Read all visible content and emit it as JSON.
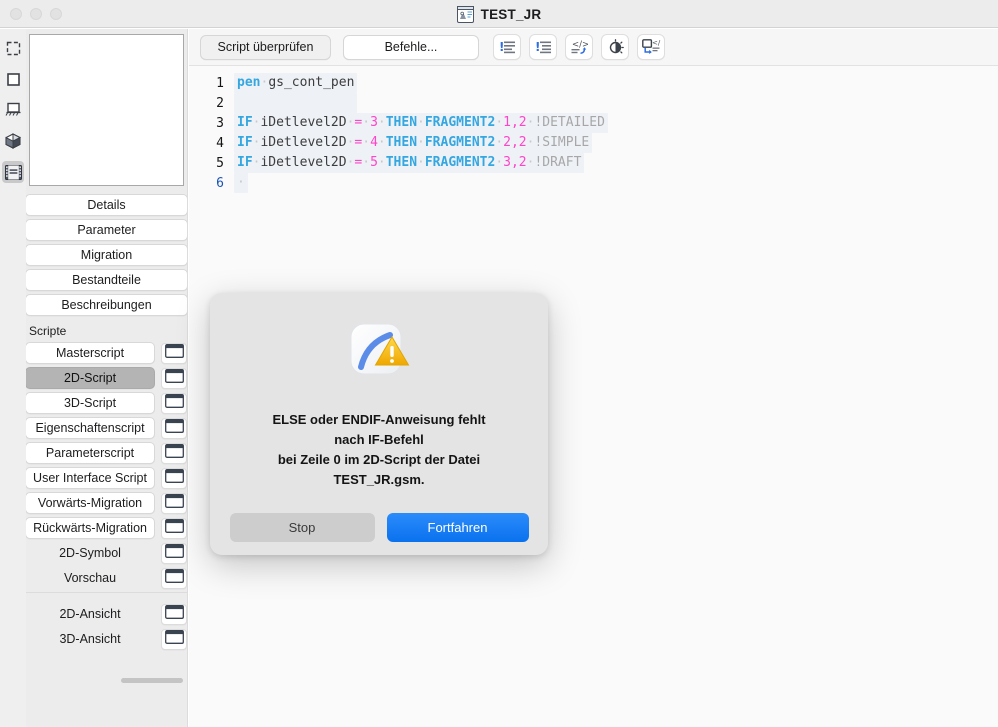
{
  "window": {
    "title": "TEST_JR",
    "doc_icon": "library-part-icon",
    "traffic_lights": [
      "close-button",
      "minimize-button",
      "zoom-button"
    ]
  },
  "iconstrip": {
    "items": [
      {
        "name": "selection-tool-icon",
        "selected": false
      },
      {
        "name": "rectangle-tool-icon",
        "selected": false
      },
      {
        "name": "floorplan-symbol-icon",
        "selected": false
      },
      {
        "name": "3d-cube-icon",
        "selected": false
      },
      {
        "name": "filmstrip-script-icon",
        "selected": true
      }
    ]
  },
  "sidebar": {
    "preview": "part-preview-empty",
    "nav_items": [
      {
        "label": "Details"
      },
      {
        "label": "Parameter"
      },
      {
        "label": "Migration"
      },
      {
        "label": "Bestandteile"
      },
      {
        "label": "Beschreibungen"
      }
    ],
    "section_label": "Scripte",
    "scripts": [
      {
        "label": "Masterscript",
        "selected": false,
        "plain": false,
        "window_button": true
      },
      {
        "label": "2D-Script",
        "selected": true,
        "plain": false,
        "window_button": true
      },
      {
        "label": "3D-Script",
        "selected": false,
        "plain": false,
        "window_button": true
      },
      {
        "label": "Eigenschaftenscript",
        "selected": false,
        "plain": false,
        "window_button": true
      },
      {
        "label": "Parameterscript",
        "selected": false,
        "plain": false,
        "window_button": true
      },
      {
        "label": "User Interface Script",
        "selected": false,
        "plain": false,
        "window_button": true
      },
      {
        "label": "Vorwärts-Migration",
        "selected": false,
        "plain": false,
        "window_button": true
      },
      {
        "label": "Rückwärts-Migration",
        "selected": false,
        "plain": false,
        "window_button": true
      },
      {
        "label": "2D-Symbol",
        "selected": false,
        "plain": true,
        "window_button": true
      },
      {
        "label": "Vorschau",
        "selected": false,
        "plain": true,
        "window_button": true
      }
    ],
    "views": [
      {
        "label": "2D-Ansicht",
        "plain": true,
        "window_button": true
      },
      {
        "label": "3D-Ansicht",
        "plain": true,
        "window_button": true
      }
    ]
  },
  "toolbar": {
    "check_script_label": "Script überprüfen",
    "commands_label": "Befehle...",
    "icons": [
      {
        "name": "indent-errors-left-icon"
      },
      {
        "name": "indent-errors-right-icon"
      },
      {
        "name": "code-export-icon"
      },
      {
        "name": "contrast-icon"
      },
      {
        "name": "code-window-icon"
      }
    ]
  },
  "editor": {
    "lines": [
      {
        "number": "1",
        "current": false,
        "tokens": [
          {
            "t": "pen",
            "c": "kw"
          },
          {
            "t": "·",
            "c": "dot"
          },
          {
            "t": "gs_cont_pen",
            "c": "id"
          }
        ]
      },
      {
        "number": "2",
        "current": false,
        "tokens": []
      },
      {
        "number": "3",
        "current": false,
        "tokens": [
          {
            "t": "IF",
            "c": "kw"
          },
          {
            "t": "·",
            "c": "dot"
          },
          {
            "t": "iDetlevel2D",
            "c": "id"
          },
          {
            "t": "·",
            "c": "dot"
          },
          {
            "t": "=",
            "c": "op"
          },
          {
            "t": "·",
            "c": "dot"
          },
          {
            "t": "3",
            "c": "num"
          },
          {
            "t": "·",
            "c": "dot"
          },
          {
            "t": "THEN",
            "c": "kw"
          },
          {
            "t": "·",
            "c": "dot"
          },
          {
            "t": "FRAGMENT2",
            "c": "kw"
          },
          {
            "t": "·",
            "c": "dot"
          },
          {
            "t": "1,2",
            "c": "num"
          },
          {
            "t": "·",
            "c": "dot"
          },
          {
            "t": "!DETAILED",
            "c": "cmt"
          }
        ]
      },
      {
        "number": "4",
        "current": false,
        "tokens": [
          {
            "t": "IF",
            "c": "kw"
          },
          {
            "t": "·",
            "c": "dot"
          },
          {
            "t": "iDetlevel2D",
            "c": "id"
          },
          {
            "t": "·",
            "c": "dot"
          },
          {
            "t": "=",
            "c": "op"
          },
          {
            "t": "·",
            "c": "dot"
          },
          {
            "t": "4",
            "c": "num"
          },
          {
            "t": "·",
            "c": "dot"
          },
          {
            "t": "THEN",
            "c": "kw"
          },
          {
            "t": "·",
            "c": "dot"
          },
          {
            "t": "FRAGMENT2",
            "c": "kw"
          },
          {
            "t": "·",
            "c": "dot"
          },
          {
            "t": "2,2",
            "c": "num"
          },
          {
            "t": "·",
            "c": "dot"
          },
          {
            "t": "!SIMPLE",
            "c": "cmt"
          }
        ]
      },
      {
        "number": "5",
        "current": false,
        "tokens": [
          {
            "t": "IF",
            "c": "kw"
          },
          {
            "t": "·",
            "c": "dot"
          },
          {
            "t": "iDetlevel2D",
            "c": "id"
          },
          {
            "t": "·",
            "c": "dot"
          },
          {
            "t": "=",
            "c": "op"
          },
          {
            "t": "·",
            "c": "dot"
          },
          {
            "t": "5",
            "c": "num"
          },
          {
            "t": "·",
            "c": "dot"
          },
          {
            "t": "THEN",
            "c": "kw"
          },
          {
            "t": "·",
            "c": "dot"
          },
          {
            "t": "FRAGMENT2",
            "c": "kw"
          },
          {
            "t": "·",
            "c": "dot"
          },
          {
            "t": "3,2",
            "c": "num"
          },
          {
            "t": "·",
            "c": "dot"
          },
          {
            "t": "!DRAFT",
            "c": "cmt"
          }
        ]
      },
      {
        "number": "6",
        "current": true,
        "tokens": [
          {
            "t": "·",
            "c": "dot"
          }
        ]
      }
    ]
  },
  "dialog": {
    "icon": "script-warning-icon",
    "message": "ELSE oder ENDIF-Anweisung fehlt\nnach IF-Befehl\nbei Zeile 0 im 2D-Script der Datei\nTEST_JR.gsm.",
    "cancel_label": "Stop",
    "confirm_label": "Fortfahren"
  },
  "colors": {
    "accent_blue": "#1a7ef5",
    "keyword_blue": "#35a7e0",
    "number_magenta": "#ff44c8",
    "comment_gray": "#a7a7a7",
    "warning_yellow": "#f5b800",
    "selection_gray": "#b4b4b4"
  }
}
